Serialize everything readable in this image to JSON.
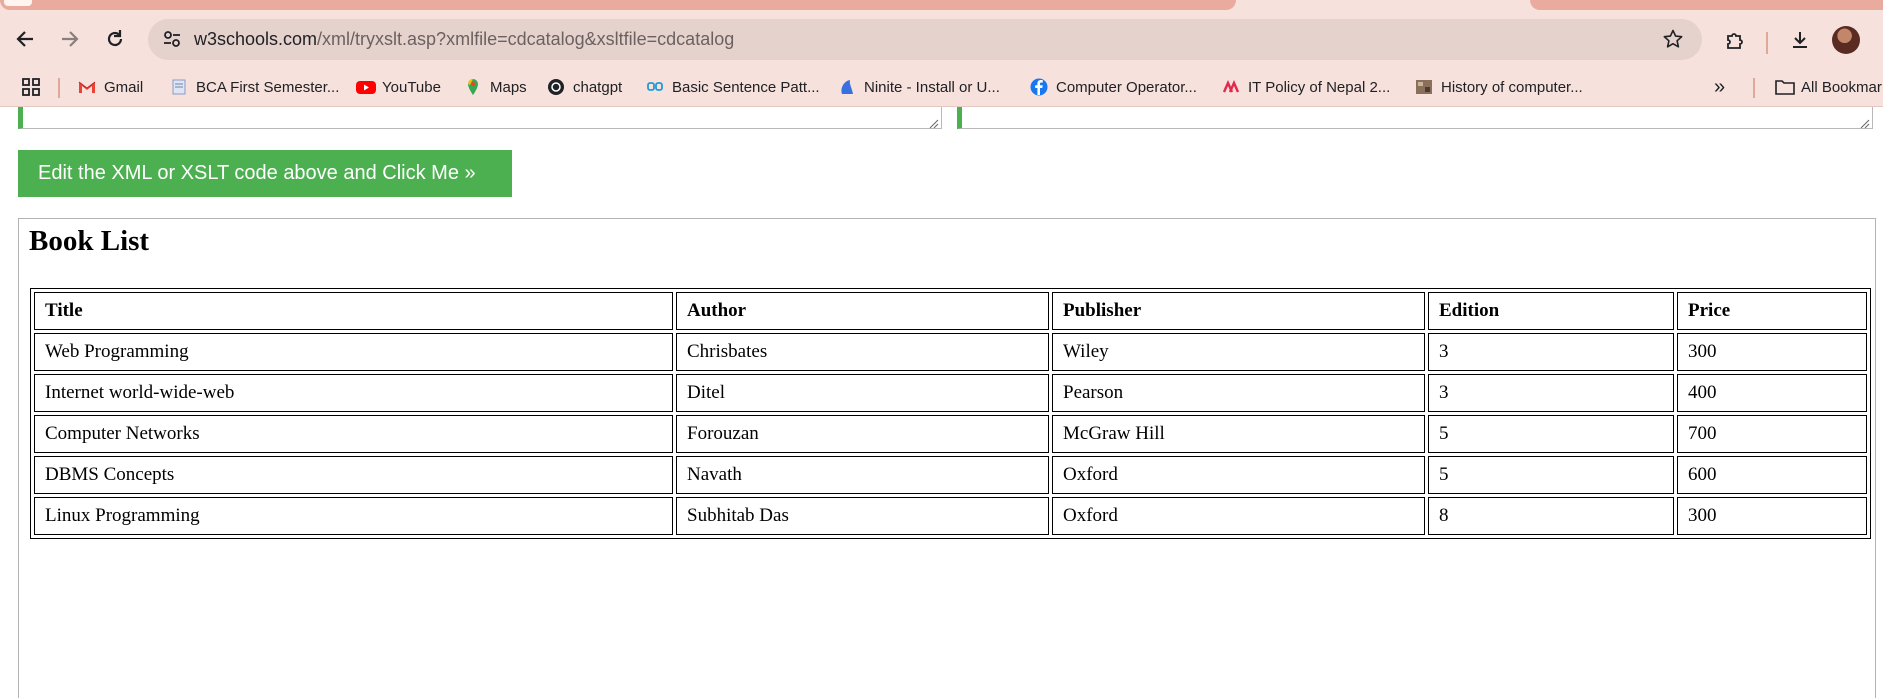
{
  "browser": {
    "url_host": "w3schools.com",
    "url_path": "/xml/tryxslt.asp?xmlfile=cdcatalog&xsltfile=cdcatalog",
    "icons": {
      "back": "back-arrow-icon",
      "forward": "forward-arrow-icon",
      "reload": "reload-icon",
      "site_info": "tune-icon",
      "bookmark_star": "star-icon",
      "extensions": "puzzle-icon",
      "downloads": "download-icon"
    },
    "colors": {
      "frame": "#f6e1dc",
      "omnibox": "#e6d2cd",
      "tab": "#e8ab9d"
    }
  },
  "bookmarks": {
    "items": [
      {
        "label": "Gmail",
        "icon": "gmail-icon"
      },
      {
        "label": "BCA First Semester...",
        "icon": "document-icon"
      },
      {
        "label": "YouTube",
        "icon": "youtube-icon"
      },
      {
        "label": "Maps",
        "icon": "maps-icon"
      },
      {
        "label": "chatgpt",
        "icon": "chatgpt-icon"
      },
      {
        "label": "Basic Sentence Patt...",
        "icon": "quote-icon"
      },
      {
        "label": "Ninite - Install or U...",
        "icon": "ninite-icon"
      },
      {
        "label": "Computer Operator...",
        "icon": "facebook-icon"
      },
      {
        "label": "IT Policy of Nepal 2...",
        "icon": "policy-icon"
      },
      {
        "label": "History of computer...",
        "icon": "image-icon"
      }
    ],
    "more": "»",
    "all_bookmarks": "All Bookmar"
  },
  "page": {
    "button_label": "Edit the XML or XSLT code above and Click Me »",
    "button_color": "#4caf50",
    "result": {
      "heading": "Book List",
      "columns": [
        "Title",
        "Author",
        "Publisher",
        "Edition",
        "Price"
      ],
      "rows": [
        [
          "Web Programming",
          "Chrisbates",
          "Wiley",
          "3",
          "300"
        ],
        [
          "Internet world-wide-web",
          "Ditel",
          "Pearson",
          "3",
          "400"
        ],
        [
          "Computer Networks",
          "Forouzan",
          "McGraw Hill",
          "5",
          "700"
        ],
        [
          "DBMS Concepts",
          "Navath",
          "Oxford",
          "5",
          "600"
        ],
        [
          "Linux Programming",
          "Subhitab Das",
          "Oxford",
          "8",
          "300"
        ]
      ]
    }
  }
}
